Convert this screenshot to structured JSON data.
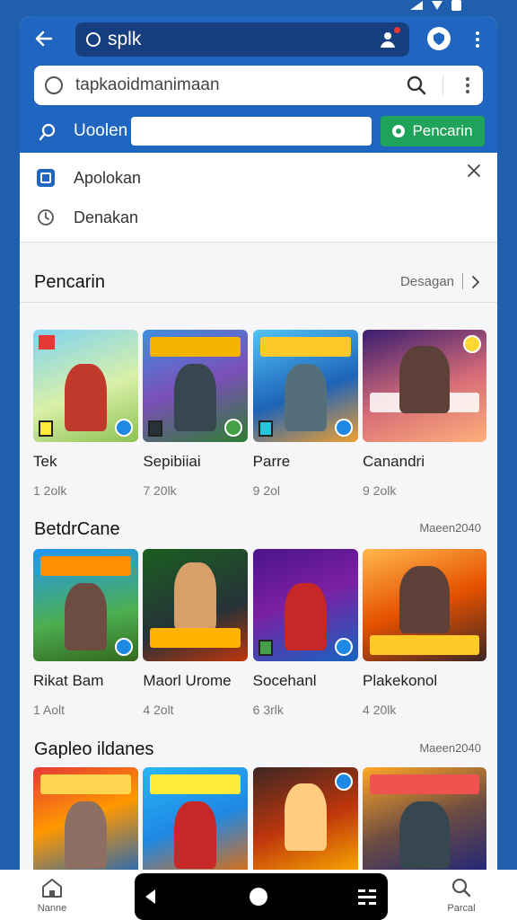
{
  "topbar": {
    "url_text": "splk"
  },
  "search": {
    "query": "tapkaoidmanimaan"
  },
  "filter": {
    "label": "Uoolen",
    "go_label": "Pencarin"
  },
  "dropdown": {
    "items": [
      {
        "label": "Apolokan",
        "icon": "app-icon"
      },
      {
        "label": "Denakan",
        "icon": "history-icon"
      }
    ]
  },
  "sections": [
    {
      "title": "Pencarin",
      "more": "Desagan",
      "cards": [
        {
          "name": "Tek",
          "meta": "1 2olk"
        },
        {
          "name": "Sepibiiai",
          "meta": "7 20lk"
        },
        {
          "name": "Parre",
          "meta": "9 2ol"
        },
        {
          "name": "Canandri",
          "meta": "9 2olk"
        }
      ]
    },
    {
      "title": "BetdrCane",
      "more": "Maeen2040",
      "cards": [
        {
          "name": "Rikat Bam",
          "meta": "1 Aolt"
        },
        {
          "name": "Maorl Urome",
          "meta": "4 2olt"
        },
        {
          "name": "Socehanl",
          "meta": "6 3rlk"
        },
        {
          "name": "Plakekonol",
          "meta": "4 20lk"
        }
      ]
    },
    {
      "title": "Gapleo ildanes",
      "more": "Maeen2040",
      "cards": [
        {
          "name": "",
          "meta": ""
        },
        {
          "name": "",
          "meta": ""
        },
        {
          "name": "",
          "meta": ""
        },
        {
          "name": "",
          "meta": ""
        }
      ]
    }
  ],
  "bottom_nav": {
    "home_label": "Nanne",
    "search_label": "Parcal"
  },
  "colors": {
    "primary": "#2066c1",
    "url_bg": "#173f80",
    "accent_green": "#1fa35a",
    "page_bg": "#1f5fae"
  }
}
